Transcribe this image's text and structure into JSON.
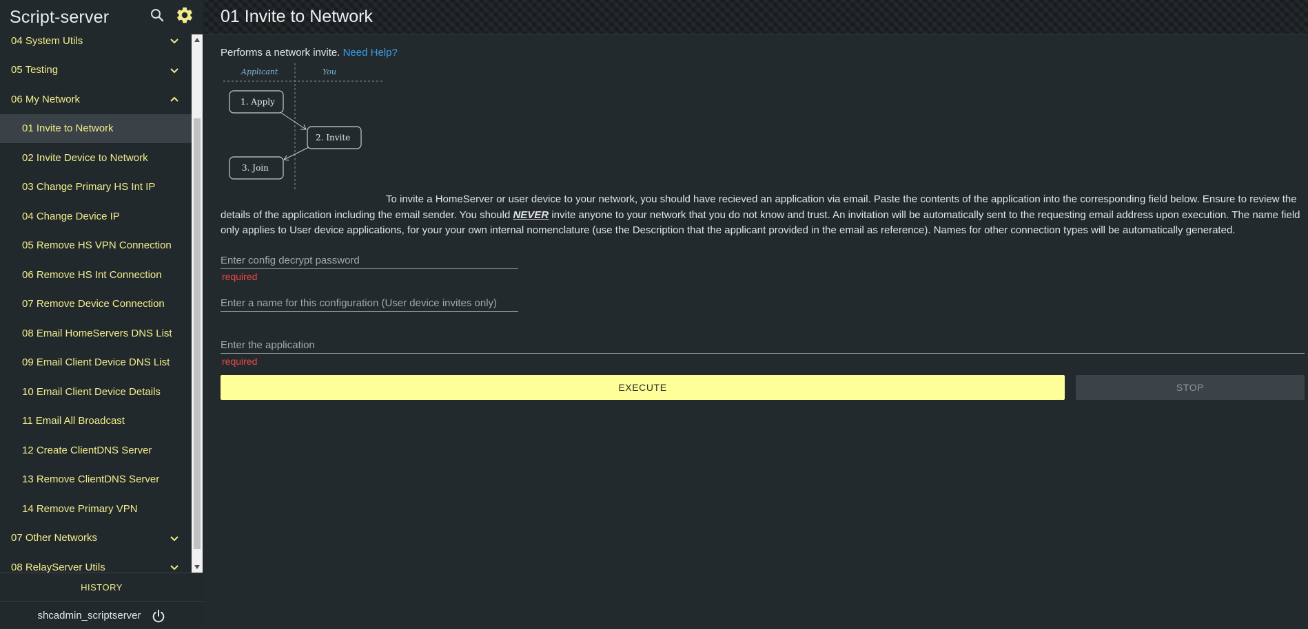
{
  "app": {
    "title": "Script-server"
  },
  "sidebar": {
    "items": [
      {
        "label": "04 System Utils",
        "type": "group",
        "expanded": false
      },
      {
        "label": "05 Testing",
        "type": "group",
        "expanded": false
      },
      {
        "label": "06 My Network",
        "type": "group",
        "expanded": true
      },
      {
        "label": "01 Invite to Network",
        "type": "script",
        "active": true
      },
      {
        "label": "02 Invite Device to Network",
        "type": "script"
      },
      {
        "label": "03 Change Primary HS Int IP",
        "type": "script"
      },
      {
        "label": "04 Change Device IP",
        "type": "script"
      },
      {
        "label": "05 Remove HS VPN Connection",
        "type": "script"
      },
      {
        "label": "06 Remove HS Int Connection",
        "type": "script"
      },
      {
        "label": "07 Remove Device Connection",
        "type": "script"
      },
      {
        "label": "08 Email HomeServers DNS List",
        "type": "script"
      },
      {
        "label": "09 Email Client Device DNS List",
        "type": "script"
      },
      {
        "label": "10 Email Client Device Details",
        "type": "script"
      },
      {
        "label": "11 Email All Broadcast",
        "type": "script"
      },
      {
        "label": "12 Create ClientDNS Server",
        "type": "script"
      },
      {
        "label": "13 Remove ClientDNS Server",
        "type": "script"
      },
      {
        "label": "14 Remove Primary VPN",
        "type": "script"
      },
      {
        "label": "07 Other Networks",
        "type": "group",
        "expanded": false
      },
      {
        "label": "08 RelayServer Utils",
        "type": "group",
        "expanded": false
      }
    ],
    "history_label": "HISTORY",
    "username": "shcadmin_scriptserver"
  },
  "main": {
    "title": "01 Invite to Network",
    "intro": "Performs a network invite.",
    "help_link": "Need Help?",
    "diagram": {
      "col_left": "Applicant",
      "col_right": "You",
      "step1": "1. Apply",
      "step2": "2. Invite",
      "step3": "3. Join"
    },
    "description_part1": "To invite a HomeServer or user device to your network, you should have recieved an application via email. Paste the contents of the application into the corresponding field below. Ensure to review the details of the application including the email sender. You should ",
    "description_emphasis": "NEVER",
    "description_part2": " invite anyone to your network that you do not know and trust. An invitation will be automatically sent to the requesting email address upon execution. The name field only applies to User device applications, for your your own internal nomenclature (use the Description that the applicant provided in the email as reference). Names for other connection types will be automatically generated.",
    "fields": {
      "password_placeholder": "Enter config decrypt password",
      "password_value": "",
      "password_error": "required",
      "name_placeholder": "Enter a name for this configuration (User device invites only)",
      "name_value": "",
      "application_placeholder": "Enter the application",
      "application_value": "",
      "application_error": "required"
    },
    "buttons": {
      "execute": "EXECUTE",
      "stop": "STOP"
    }
  },
  "colors": {
    "accent_yellow": "#f2ec8a",
    "execute_bg": "#ffff99",
    "link": "#3aa0e6",
    "error": "#f0483e",
    "background": "#232a2e"
  }
}
